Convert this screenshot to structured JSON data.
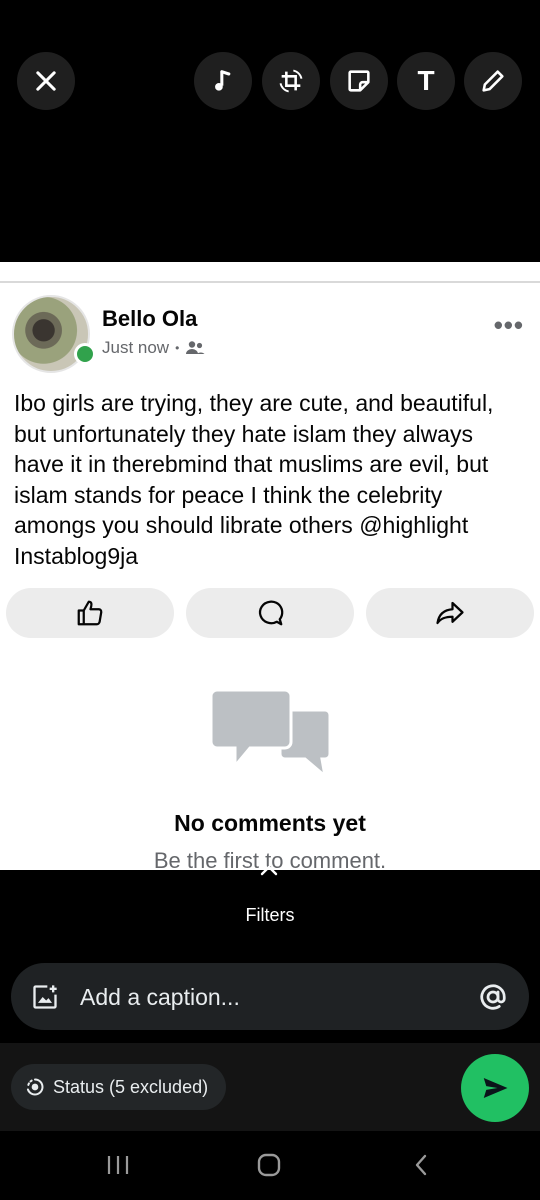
{
  "toolbar": {
    "icons": [
      "close-icon",
      "music-icon",
      "crop-rotate-icon",
      "sticker-icon",
      "text-icon",
      "pencil-icon"
    ],
    "text_tool_label": "T"
  },
  "post": {
    "author": "Bello Ola",
    "timestamp": "Just now",
    "separator": "•",
    "audience_icon": "friends-icon",
    "more_label": "•••",
    "text": "Ibo girls are trying,  they are cute, and beautiful,  but unfortunately they hate islam they always have it in therebmind that muslims are evil, but islam stands for peace I think the celebrity amongs you should librate others @highlight Instablog9ja",
    "actions": [
      "like-icon",
      "comment-icon",
      "share-icon"
    ],
    "empty_title": "No comments yet",
    "empty_subtitle": "Be the first to comment.",
    "online_color": "#31a24c"
  },
  "editor": {
    "filters_label": "Filters",
    "caption_placeholder": "Add a caption...",
    "mention_icon": "at-icon",
    "status_label": "Status (5 excluded)",
    "send_color": "#21c063"
  },
  "navbar": {
    "icons": [
      "recent-apps-icon",
      "home-icon",
      "back-icon"
    ]
  }
}
